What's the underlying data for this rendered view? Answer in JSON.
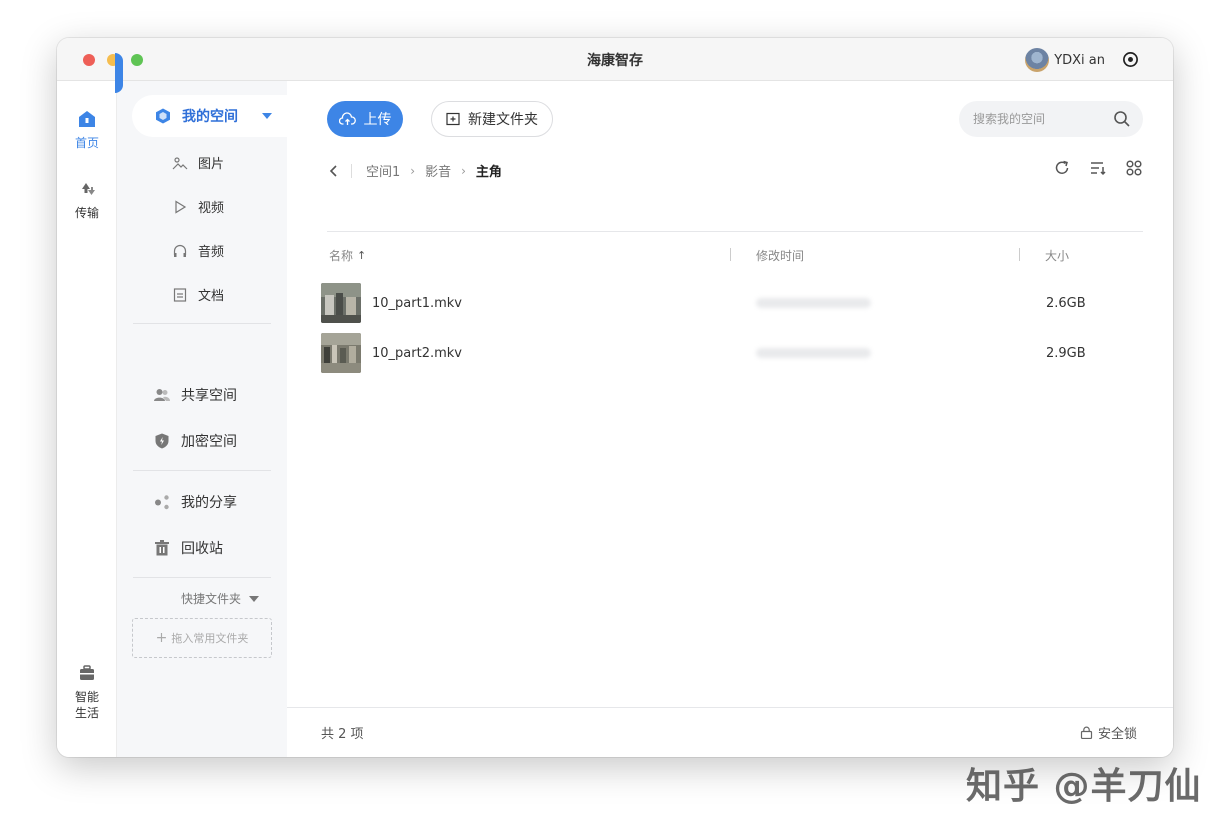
{
  "window": {
    "title": "海康智存",
    "user_name": "YDXi an"
  },
  "rail": {
    "home": "首页",
    "transfer": "传输",
    "smart_life_1": "智能",
    "smart_life_2": "生活"
  },
  "sidebar": {
    "my_space": "我的空间",
    "sub_items": [
      "图片",
      "视频",
      "音频",
      "文档"
    ],
    "shared_space": "共享空间",
    "encrypted_space": "加密空间",
    "my_share": "我的分享",
    "recycle_bin": "回收站",
    "quick_folder": "快捷文件夹",
    "drop_hint": "拖入常用文件夹"
  },
  "toolbar": {
    "upload": "上传",
    "new_folder": "新建文件夹",
    "search_placeholder": "搜索我的空间"
  },
  "breadcrumb": [
    "空间1",
    "影音",
    "主角"
  ],
  "table": {
    "columns": [
      "名称",
      "修改时间",
      "大小"
    ],
    "sort_indicator": "↑",
    "rows": [
      {
        "name": "10_part1.mkv",
        "size": "2.6GB"
      },
      {
        "name": "10_part2.mkv",
        "size": "2.9GB"
      }
    ]
  },
  "footer": {
    "count": "共 2 项",
    "lock": "安全锁"
  },
  "watermark": "知乎 @羊刀仙",
  "colors": {
    "accent": "#3d85e6",
    "sidebar_bg": "#f6f7f9"
  }
}
